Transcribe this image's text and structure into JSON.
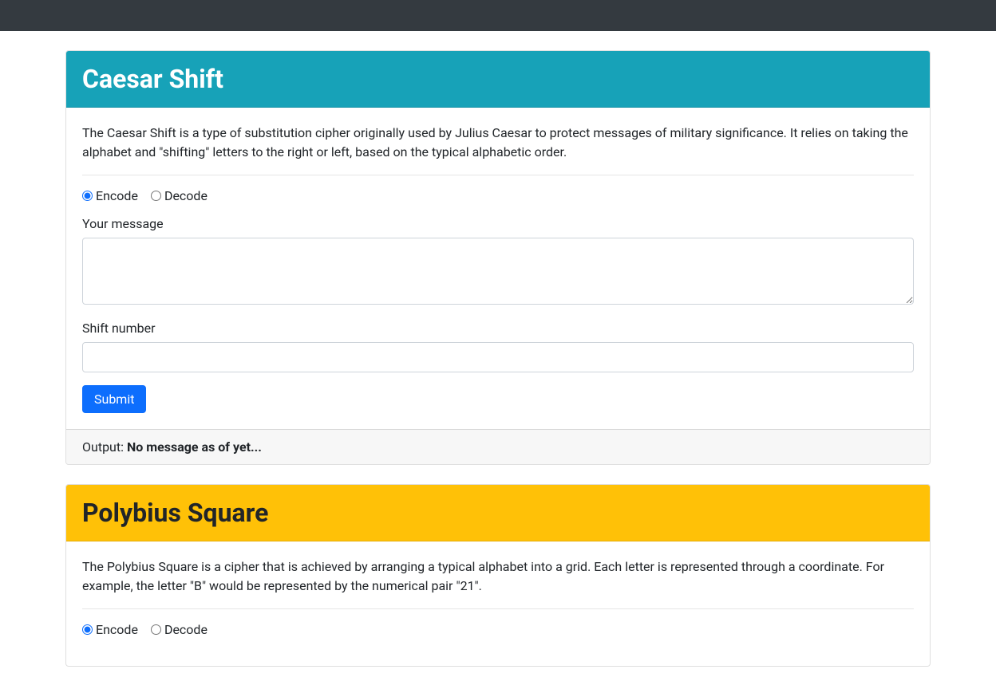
{
  "caesar": {
    "title": "Caesar Shift",
    "description": "The Caesar Shift is a type of substitution cipher originally used by Julius Caesar to protect messages of military significance. It relies on taking the alphabet and \"shifting\" letters to the right or left, based on the typical alphabetic order.",
    "encode_label": "Encode",
    "decode_label": "Decode",
    "message_label": "Your message",
    "message_value": "",
    "shift_label": "Shift number",
    "shift_value": "",
    "submit_label": "Submit",
    "output_prefix": "Output: ",
    "output_value": "No message as of yet..."
  },
  "polybius": {
    "title": "Polybius Square",
    "description": "The Polybius Square is a cipher that is achieved by arranging a typical alphabet into a grid. Each letter is represented through a coordinate. For example, the letter \"B\" would be represented by the numerical pair \"21\".",
    "encode_label": "Encode",
    "decode_label": "Decode"
  },
  "colors": {
    "info_bg": "#17a2b8",
    "warning_bg": "#ffc107",
    "primary": "#0d6efd",
    "navbar": "#343a40"
  }
}
